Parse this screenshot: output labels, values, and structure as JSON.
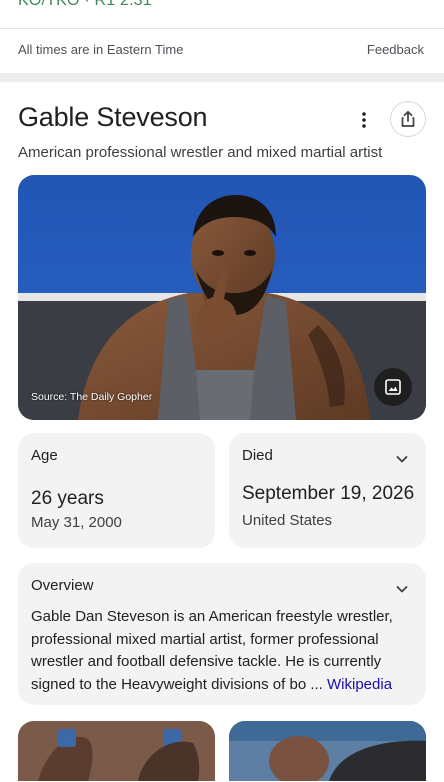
{
  "top": {
    "result_line": "KO/TKO · R1 2:31"
  },
  "times_bar": {
    "note": "All times are in Eastern Time",
    "feedback": "Feedback"
  },
  "knowledge_panel": {
    "title": "Gable Steveson",
    "subtitle": "American professional wrestler and mixed martial artist",
    "image": {
      "source_text": "Source: The Daily Gopher"
    },
    "facts": {
      "age": {
        "label": "Age",
        "value": "26 years",
        "sub": "May 31, 2000"
      },
      "died": {
        "label": "Died",
        "value": "September 19, 2026",
        "sub": "United States"
      }
    },
    "overview": {
      "heading": "Overview",
      "text": "Gable Dan Steveson is an American freestyle wrestler, professional mixed martial artist, former professional wrestler and football defensive tackle. He is currently signed to the Heavyweight divisions of bo ...",
      "link": "Wikipedia"
    }
  },
  "colors": {
    "link": "#1a0dab",
    "result_green": "#3c8a5a",
    "box_bg": "#f3f3f3"
  },
  "icons": [
    "more-vert-icon",
    "share-icon",
    "images-icon",
    "chevron-down-icon"
  ]
}
